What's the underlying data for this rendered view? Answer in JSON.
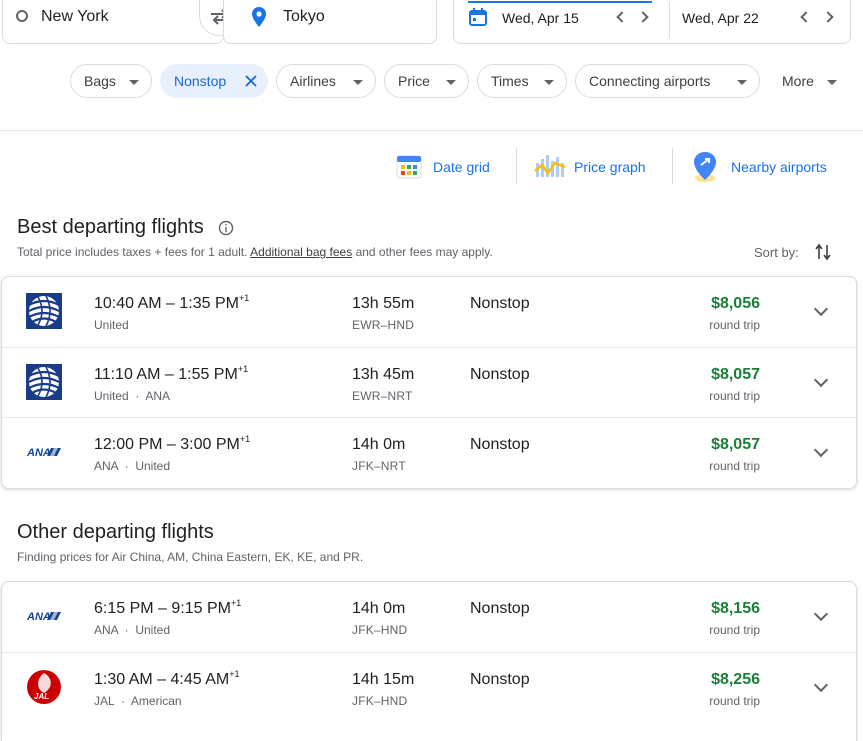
{
  "search": {
    "origin": "New York",
    "destination": "Tokyo",
    "depart_date": "Wed, Apr 15",
    "return_date": "Wed, Apr 22"
  },
  "filters": {
    "bags": "Bags",
    "nonstop": "Nonstop",
    "airlines": "Airlines",
    "price": "Price",
    "times": "Times",
    "connecting": "Connecting airports",
    "more": "More"
  },
  "toolbar": {
    "date_grid": "Date grid",
    "price_graph": "Price graph",
    "nearby": "Nearby airports"
  },
  "best": {
    "title": "Best departing flights",
    "note_pre": "Total price includes taxes + fees for 1 adult.",
    "note_link": "Additional bag fees",
    "note_post": "and other fees may apply.",
    "sort_label": "Sort by:",
    "flights": [
      {
        "dep": "10:40 AM",
        "arr": "1:35 PM",
        "plus": "+1",
        "airlines": "United",
        "duration": "13h 55m",
        "route": "EWR–HND",
        "stops": "Nonstop",
        "price": "$8,056",
        "price_note": "round trip"
      },
      {
        "dep": "11:10 AM",
        "arr": "1:55 PM",
        "plus": "+1",
        "airlines": "United  ·  ANA",
        "duration": "13h 45m",
        "route": "EWR–NRT",
        "stops": "Nonstop",
        "price": "$8,057",
        "price_note": "round trip"
      },
      {
        "dep": "12:00 PM",
        "arr": "3:00 PM",
        "plus": "+1",
        "airlines": "ANA  ·  United",
        "duration": "14h 0m",
        "route": "JFK–NRT",
        "stops": "Nonstop",
        "price": "$8,057",
        "price_note": "round trip"
      }
    ]
  },
  "other": {
    "title": "Other departing flights",
    "note": "Finding prices for Air China, AM, China Eastern, EK, KE, and PR.",
    "flights": [
      {
        "dep": "6:15 PM",
        "arr": "9:15 PM",
        "plus": "+1",
        "airlines": "ANA  ·  United",
        "duration": "14h 0m",
        "route": "JFK–HND",
        "stops": "Nonstop",
        "price": "$8,156",
        "price_note": "round trip"
      },
      {
        "dep": "1:30 AM",
        "arr": "4:45 AM",
        "plus": "+1",
        "airlines": "JAL  ·  American",
        "duration": "14h 15m",
        "route": "JFK–HND",
        "stops": "Nonstop",
        "price": "$8,256",
        "price_note": "round trip"
      }
    ]
  },
  "logos": {
    "ana": "ANA",
    "jal": "JAL"
  },
  "colors": {
    "accent": "#1a73e8",
    "price": "#188038",
    "chip_active": "#e8f0fe"
  }
}
